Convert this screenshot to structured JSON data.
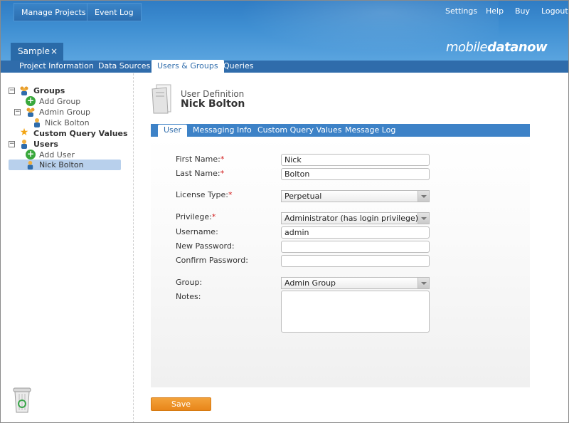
{
  "header": {
    "manage_projects": "Manage Projects",
    "event_log": "Event Log",
    "links": [
      "Settings",
      "Help",
      "Buy",
      "Logout"
    ],
    "logo_light": "mobile",
    "logo_bold": "data",
    "logo_end": "now",
    "project_tab": "Sample",
    "project_tab_close": "×"
  },
  "nav": {
    "tabs": [
      "Project Information",
      "Data Sources",
      "Users & Groups",
      "Queries"
    ],
    "active": "Users & Groups"
  },
  "tree": {
    "groups": "Groups",
    "add_group": "Add Group",
    "admin_group": "Admin Group",
    "group_member": "Nick Bolton",
    "custom_query_values": "Custom Query Values",
    "users": "Users",
    "add_user": "Add User",
    "selected_user": "Nick Bolton",
    "expand_symbol": "−"
  },
  "heading": {
    "subtitle": "User Definition",
    "title": "Nick Bolton"
  },
  "subtabs": {
    "tabs": [
      "User",
      "Messaging Info",
      "Custom Query Values",
      "Message Log"
    ],
    "active": "User"
  },
  "form": {
    "first_name_label": "First Name:",
    "first_name_value": "Nick",
    "last_name_label": "Last Name:",
    "last_name_value": "Bolton",
    "license_type_label": "License Type:",
    "license_type_value": "Perpetual",
    "privilege_label": "Privilege:",
    "privilege_value": "Administrator (has login privilege)",
    "username_label": "Username:",
    "username_value": "admin",
    "new_password_label": "New Password:",
    "new_password_value": "",
    "confirm_password_label": "Confirm Password:",
    "confirm_password_value": "",
    "group_label": "Group:",
    "group_value": "Admin Group",
    "notes_label": "Notes:",
    "notes_value": "",
    "required_marker": "*"
  },
  "actions": {
    "save": "Save"
  },
  "colors": {
    "header_blue": "#3f8fd2",
    "nav_blue": "#2f6cab",
    "save_orange": "#e8861a",
    "required_red": "#d21b1b",
    "selected_row": "#b8d0ec"
  }
}
